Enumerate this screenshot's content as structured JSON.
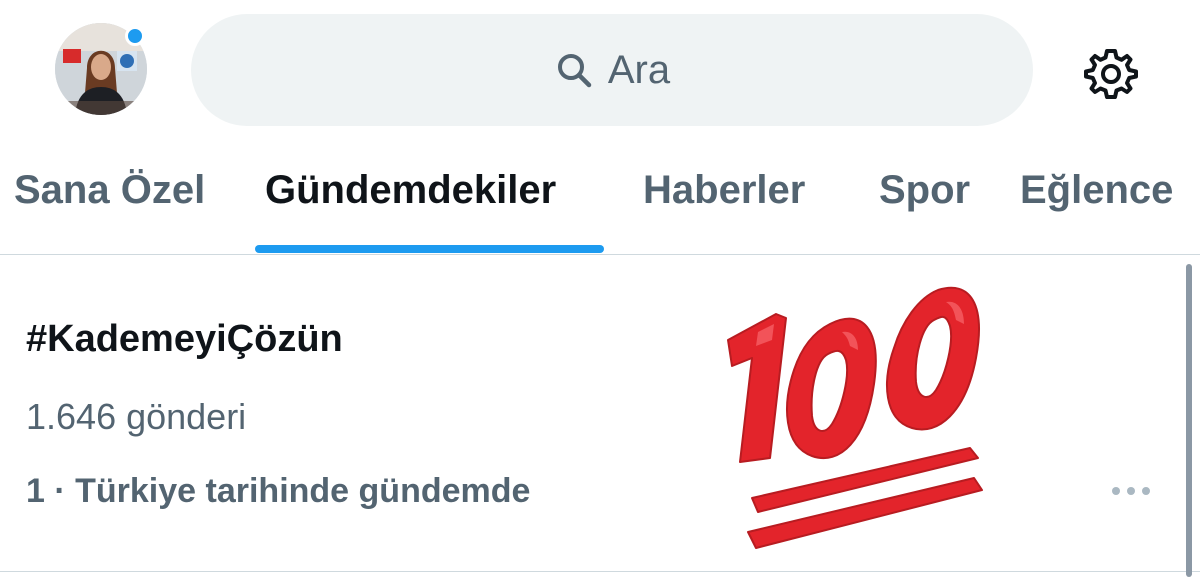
{
  "header": {
    "search_placeholder": "Ara",
    "search_icon": "search-icon",
    "settings_icon": "gear-icon",
    "notification_color": "#1d9bf0"
  },
  "tabs": [
    {
      "label": "Sana Özel",
      "active": false
    },
    {
      "label": "Gündemdekiler",
      "active": true
    },
    {
      "label": "Haberler",
      "active": false
    },
    {
      "label": "Spor",
      "active": false
    },
    {
      "label": "Eğlence",
      "active": false
    }
  ],
  "trends": [
    {
      "title": "#KademeyiÇözün",
      "post_count": "1.646 gönderi",
      "context": "1 · Türkiye tarihinde gündemde",
      "media_icon": "hundred-points-emoji"
    }
  ],
  "colors": {
    "accent": "#1d9bf0",
    "text_primary": "#0f1419",
    "text_secondary": "#536471",
    "search_background": "#eff3f4",
    "emoji_red": "#e3242b"
  }
}
